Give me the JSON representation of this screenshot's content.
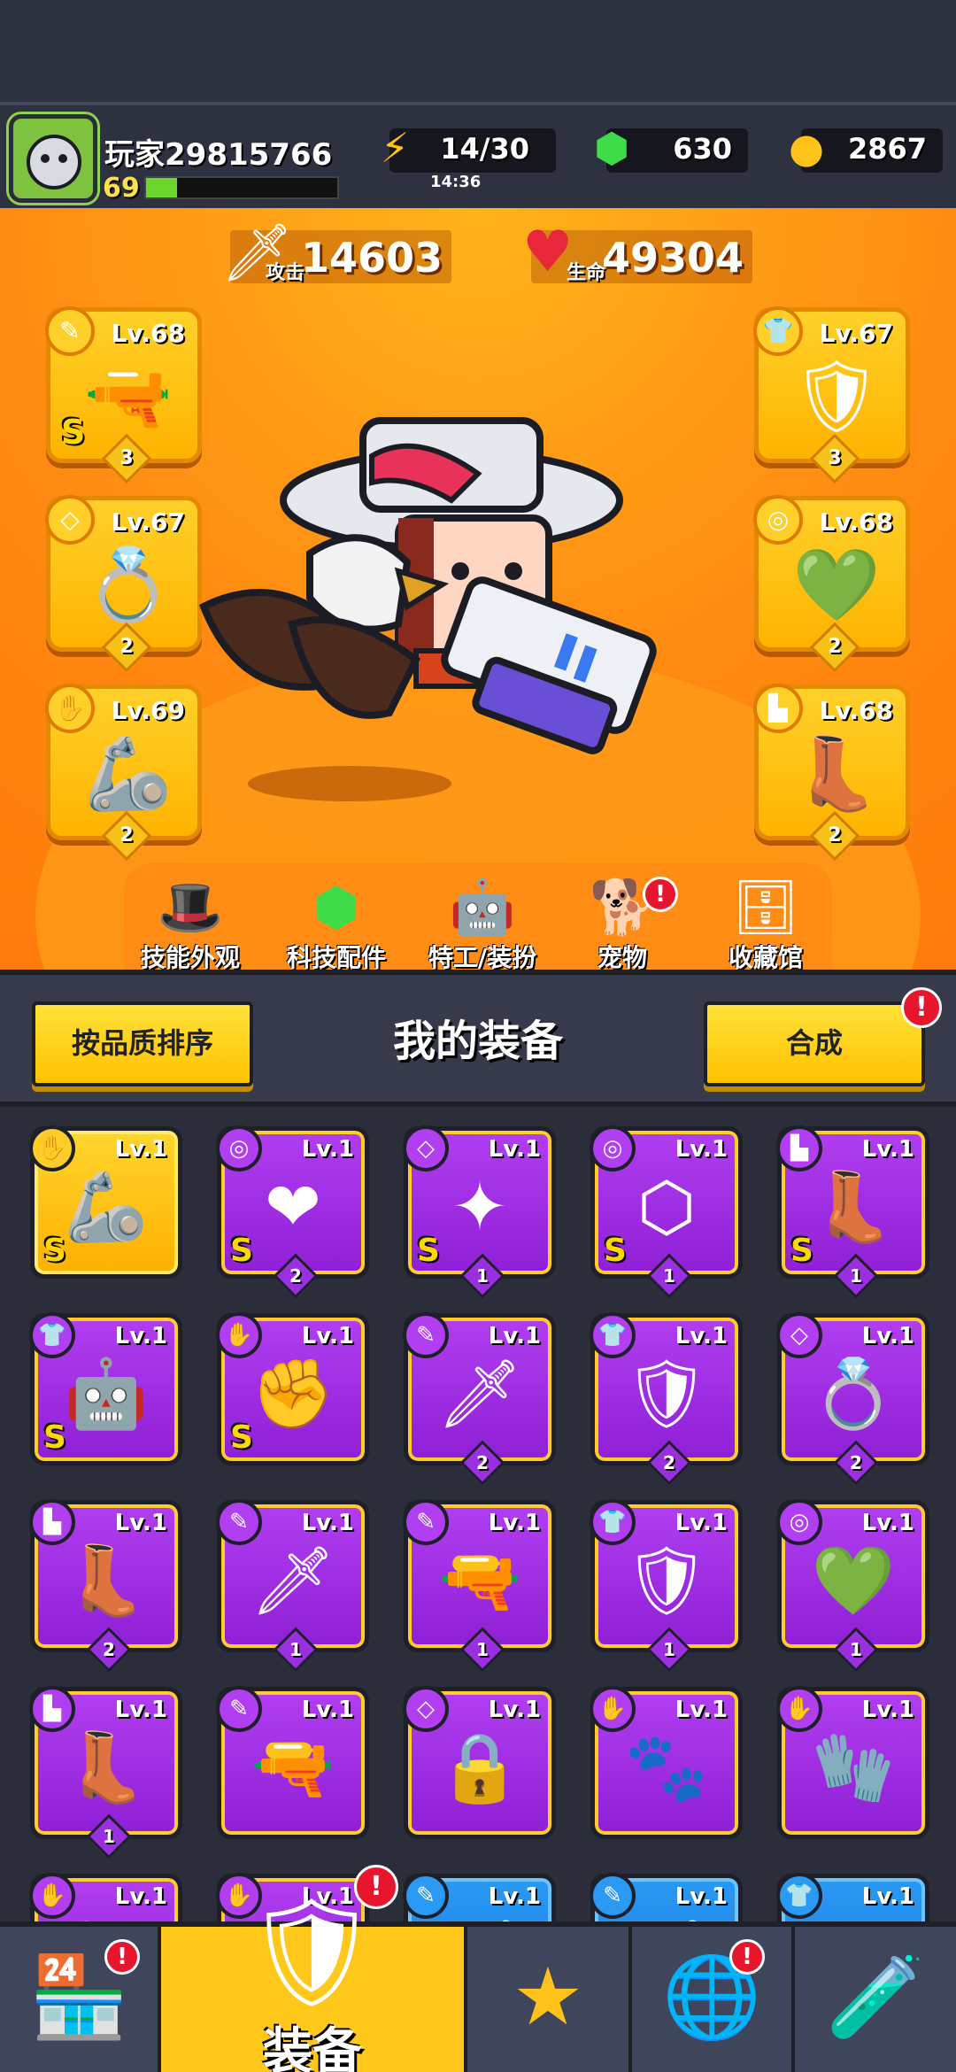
{
  "player": {
    "name": "玩家29815766",
    "level": "69",
    "xp_fraction": 0.16
  },
  "resources": {
    "energy": "14/30",
    "energy_timer": "14:36",
    "gems": "630",
    "gold": "2867"
  },
  "stats": {
    "attack_label": "攻击",
    "attack_value": "14603",
    "hp_label": "生命",
    "hp_value": "49304"
  },
  "equipped": [
    {
      "slot": "weapon",
      "level": "Lv.68",
      "stars": "3",
      "rank": "S",
      "icon": "blaster-gun"
    },
    {
      "slot": "necklace",
      "level": "Lv.67",
      "stars": "2",
      "rank": "",
      "icon": "emerald-ring"
    },
    {
      "slot": "gloves",
      "level": "Lv.69",
      "stars": "2",
      "rank": "",
      "icon": "mech-gauntlet"
    },
    {
      "slot": "armor",
      "level": "Lv.67",
      "stars": "3",
      "rank": "",
      "icon": "armor-vest"
    },
    {
      "slot": "belt",
      "level": "Lv.68",
      "stars": "2",
      "rank": "",
      "icon": "emerald-belt"
    },
    {
      "slot": "boots",
      "level": "Lv.68",
      "stars": "2",
      "rank": "",
      "icon": "mech-boot"
    }
  ],
  "subnav": [
    {
      "label": "技能外观",
      "icon": "skin-icon",
      "notify": false
    },
    {
      "label": "科技配件",
      "icon": "tech-part-icon",
      "notify": false
    },
    {
      "label": "特工/装扮",
      "icon": "agent-icon",
      "notify": false
    },
    {
      "label": "宠物",
      "icon": "pet-icon",
      "notify": true
    },
    {
      "label": "收藏馆",
      "icon": "collection-icon",
      "notify": false
    }
  ],
  "equipment_section": {
    "title": "我的装备",
    "sort_label": "按品质排序",
    "merge_label": "合成",
    "merge_notify": "!"
  },
  "inventory": [
    {
      "rarity": "legend",
      "slot": "gloves",
      "level": "Lv.1",
      "rank": "S",
      "stars": "",
      "icon": "mech-gauntlet"
    },
    {
      "rarity": "epic",
      "slot": "belt",
      "level": "Lv.1",
      "rank": "S",
      "stars": "2",
      "icon": "ruby-belt"
    },
    {
      "rarity": "epic",
      "slot": "necklace",
      "level": "Lv.1",
      "rank": "S",
      "stars": "1",
      "icon": "star-ring"
    },
    {
      "rarity": "epic",
      "slot": "belt",
      "level": "Lv.1",
      "rank": "S",
      "stars": "1",
      "icon": "winged-belt"
    },
    {
      "rarity": "epic",
      "slot": "boots",
      "level": "Lv.1",
      "rank": "S",
      "stars": "1",
      "icon": "gold-boot"
    },
    {
      "rarity": "epic",
      "slot": "armor",
      "level": "Lv.1",
      "rank": "S",
      "stars": "",
      "icon": "robot-armor"
    },
    {
      "rarity": "epic",
      "slot": "gloves",
      "level": "Lv.1",
      "rank": "S",
      "stars": "",
      "icon": "gold-gauntlet"
    },
    {
      "rarity": "epic",
      "slot": "weapon",
      "level": "Lv.1",
      "rank": "",
      "stars": "2",
      "icon": "kunai"
    },
    {
      "rarity": "epic",
      "slot": "armor",
      "level": "Lv.1",
      "rank": "",
      "stars": "2",
      "icon": "armor-vest"
    },
    {
      "rarity": "epic",
      "slot": "necklace",
      "level": "Lv.1",
      "rank": "",
      "stars": "2",
      "icon": "emerald-ring"
    },
    {
      "rarity": "epic",
      "slot": "boots",
      "level": "Lv.1",
      "rank": "",
      "stars": "2",
      "icon": "mech-boot"
    },
    {
      "rarity": "epic",
      "slot": "weapon",
      "level": "Lv.1",
      "rank": "",
      "stars": "1",
      "icon": "kunai"
    },
    {
      "rarity": "epic",
      "slot": "weapon",
      "level": "Lv.1",
      "rank": "",
      "stars": "1",
      "icon": "shotgun"
    },
    {
      "rarity": "epic",
      "slot": "armor",
      "level": "Lv.1",
      "rank": "",
      "stars": "1",
      "icon": "armor-vest"
    },
    {
      "rarity": "epic",
      "slot": "belt",
      "level": "Lv.1",
      "rank": "",
      "stars": "1",
      "icon": "emerald-belt"
    },
    {
      "rarity": "epic",
      "slot": "boots",
      "level": "Lv.1",
      "rank": "",
      "stars": "1",
      "icon": "mech-boot"
    },
    {
      "rarity": "epic",
      "slot": "weapon",
      "level": "Lv.1",
      "rank": "",
      "stars": "",
      "icon": "shotgun"
    },
    {
      "rarity": "epic",
      "slot": "necklace",
      "level": "Lv.1",
      "rank": "",
      "stars": "",
      "icon": "lock-necklace"
    },
    {
      "rarity": "epic",
      "slot": "gloves",
      "level": "Lv.1",
      "rank": "",
      "stars": "",
      "icon": "claw-glove"
    },
    {
      "rarity": "epic",
      "slot": "gloves",
      "level": "Lv.1",
      "rank": "",
      "stars": "",
      "icon": "steel-glove"
    },
    {
      "rarity": "epic",
      "slot": "gloves",
      "level": "Lv.1",
      "rank": "",
      "stars": "",
      "icon": "glove"
    },
    {
      "rarity": "epic",
      "slot": "gloves",
      "level": "Lv.1",
      "rank": "",
      "stars": "",
      "icon": "glove"
    },
    {
      "rarity": "rare",
      "slot": "weapon",
      "level": "Lv.1",
      "rank": "",
      "stars": "",
      "icon": "weapon"
    },
    {
      "rarity": "rare",
      "slot": "weapon",
      "level": "Lv.1",
      "rank": "",
      "stars": "",
      "icon": "weapon"
    },
    {
      "rarity": "rare",
      "slot": "armor",
      "level": "Lv.1",
      "rank": "",
      "stars": "",
      "icon": "armor"
    }
  ],
  "bottom_nav": [
    {
      "label": "",
      "icon": "shop-icon",
      "notify": true
    },
    {
      "label": "装备",
      "icon": "equipment-icon",
      "notify": true,
      "active": true
    },
    {
      "label": "",
      "icon": "battle-icon",
      "notify": false
    },
    {
      "label": "",
      "icon": "world-icon",
      "notify": true
    },
    {
      "label": "",
      "icon": "lab-icon",
      "notify": false
    }
  ],
  "colors": {
    "hero_bg": "#ff8a12",
    "legend": "#ffc81a",
    "epic": "#a52fe8",
    "rare": "#2a9af5",
    "notify_red": "#e8162d"
  }
}
